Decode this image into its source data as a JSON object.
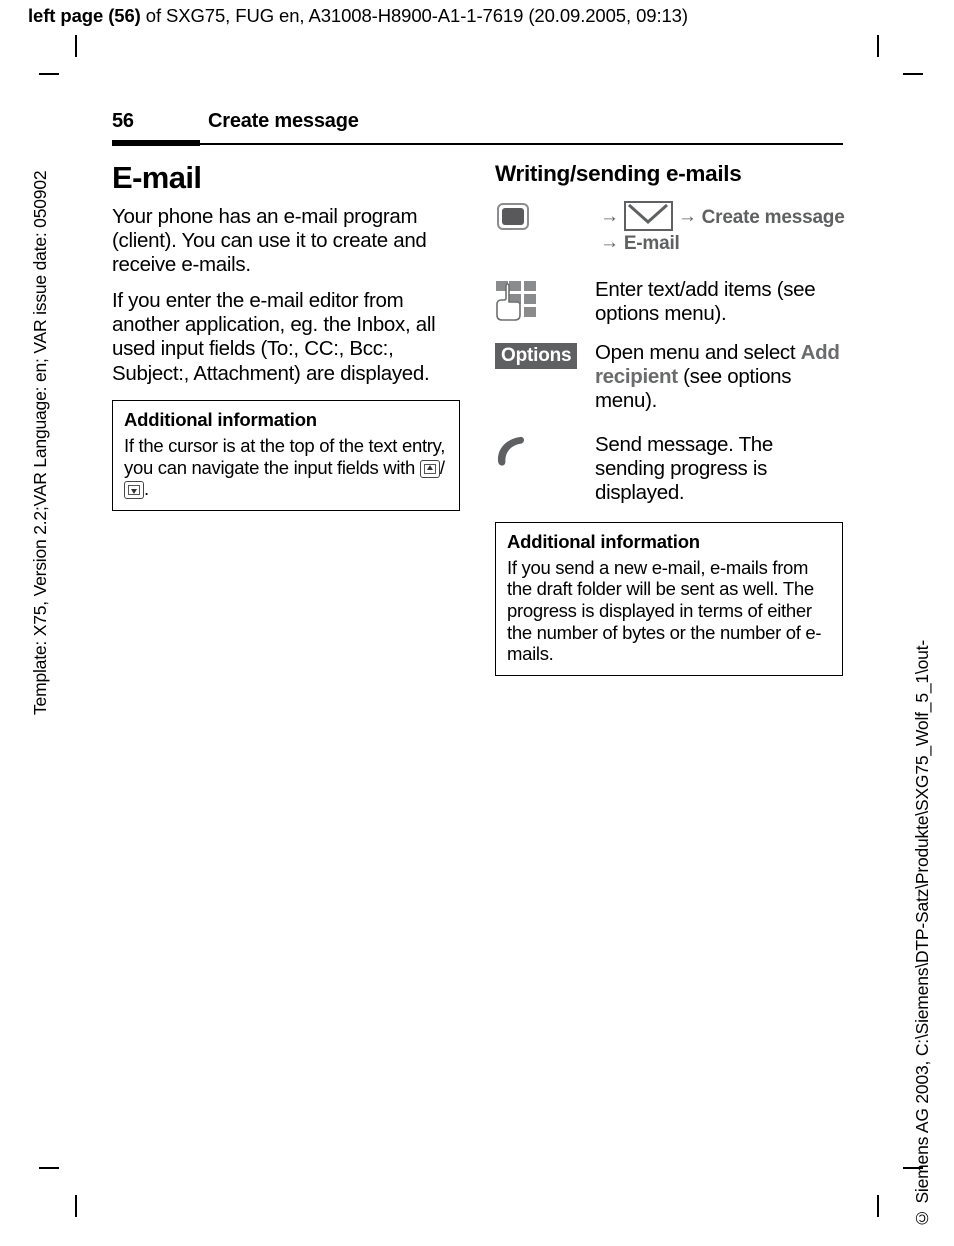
{
  "running_head": {
    "bold_prefix": "left page (56)",
    "rest": " of SXG75, FUG en, A31008-H8900-A1-1-7619 (20.09.2005, 09:13)"
  },
  "side_text": {
    "left": "Template: X75, Version 2.2;VAR Language: en; VAR issue date: 050902",
    "right": "© Siemens AG 2003, C:\\Siemens\\DTP-Satz\\Produkte\\SXG75_Wolf_5_1\\out-"
  },
  "page_header": {
    "page_number": "56",
    "chapter_title": "Create message"
  },
  "left_column": {
    "heading": "E-mail",
    "paragraphs": [
      "Your phone has an e-mail program (client). You can use it to create and receive e-mails.",
      "If you enter the e-mail editor from another application, eg. the Inbox, all used input fields (To:, CC:, Bcc:, Subject:, Attachment) are displayed."
    ],
    "info_box": {
      "title": "Additional information",
      "text_before_icons": "If the cursor is at the top of the text entry, you can navigate the input fields with ",
      "icon_up": "nav-key-up-icon",
      "icon_separator": "/",
      "icon_down": "nav-key-down-icon",
      "text_after_icons": "."
    }
  },
  "right_column": {
    "heading": "Writing/sending e-mails",
    "steps": [
      {
        "icon": "select-key-icon",
        "nav_path_line1": {
          "arrow1": "→",
          "icon_envelope": "envelope-icon",
          "arrow2": "→",
          "target": "Create message"
        },
        "nav_path_line2": {
          "arrow": "→",
          "target": "E-mail"
        }
      },
      {
        "icon": "keypad-hand-icon",
        "text": "Enter text/add items (see options menu)."
      },
      {
        "icon": "options-softkey",
        "softkey_label": "Options",
        "text_part1": "Open menu and select ",
        "text_highlight": "Add recipient",
        "text_part2": " (see options menu)."
      },
      {
        "icon": "call-key-icon",
        "text": "Send message. The sending progress is displayed."
      }
    ],
    "info_box": {
      "title": "Additional information",
      "text": "If you send a new e-mail, e-mails from the draft folder will be sent as well. The progress is displayed in terms of either the number of bytes or the number of e-mails."
    }
  },
  "colors": {
    "gray_ui": "#5f6061",
    "gray_light": "#8b8c8d",
    "text": "#000000"
  }
}
